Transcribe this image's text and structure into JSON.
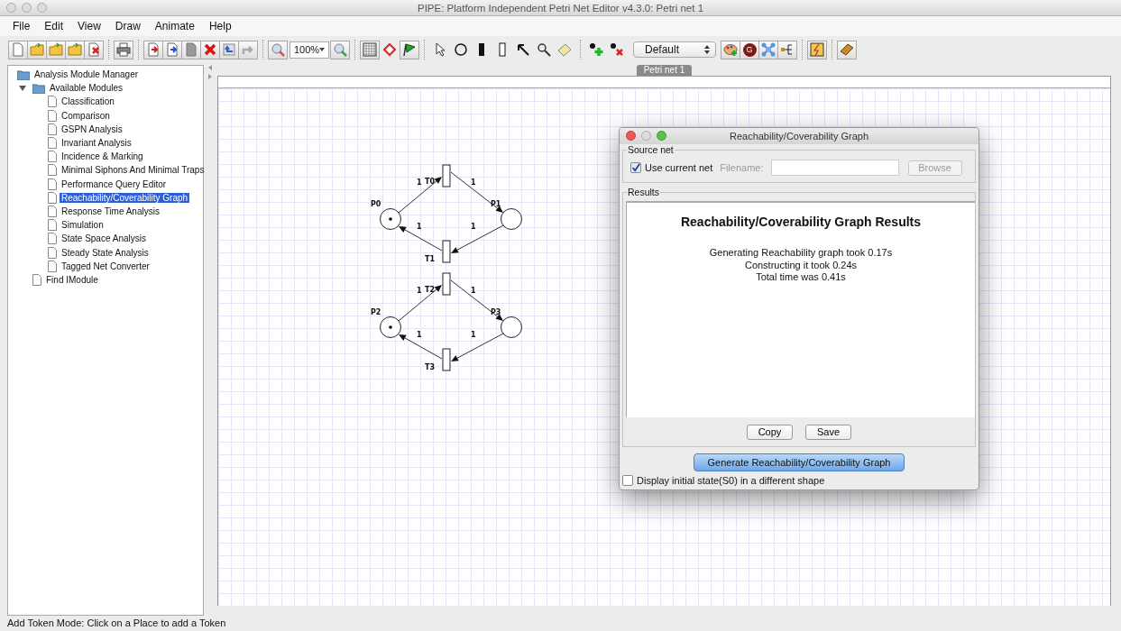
{
  "window": {
    "title": "PIPE: Platform Independent Petri Net Editor v4.3.0: Petri net 1"
  },
  "menu": [
    "File",
    "Edit",
    "View",
    "Draw",
    "Animate",
    "Help"
  ],
  "toolbar": {
    "zoom": "100%",
    "token_set": "Default",
    "rate_letter": "G"
  },
  "tree": [
    {
      "label": "Analysis Module Manager",
      "selected": false,
      "children": [
        {
          "label": "Available Modules",
          "selected": false,
          "expanded": true,
          "children": [
            {
              "label": "Classification",
              "selected": false
            },
            {
              "label": "Comparison",
              "selected": false
            },
            {
              "label": "GSPN Analysis",
              "selected": false
            },
            {
              "label": "Invariant Analysis",
              "selected": false
            },
            {
              "label": "Incidence & Marking",
              "selected": false
            },
            {
              "label": "Minimal Siphons And Minimal Traps",
              "selected": false
            },
            {
              "label": "Performance Query Editor",
              "selected": false
            },
            {
              "label": "Reachability/Coverability Graph",
              "selected": true
            },
            {
              "label": "Response Time Analysis",
              "selected": false
            },
            {
              "label": "Simulation",
              "selected": false
            },
            {
              "label": "State Space Analysis",
              "selected": false
            },
            {
              "label": "Steady State Analysis",
              "selected": false
            },
            {
              "label": "Tagged Net Converter",
              "selected": false
            }
          ]
        },
        {
          "label": "Find IModule",
          "selected": false
        }
      ]
    }
  ],
  "canvas_tab": "Petri net 1",
  "nets": [
    {
      "places": [
        {
          "label": "P0",
          "marked": true
        },
        {
          "label": "P1",
          "marked": false
        }
      ],
      "transitions": [
        {
          "label": "T0"
        },
        {
          "label": "T1"
        }
      ],
      "arc_weights": [
        "1",
        "1",
        "1",
        "1"
      ]
    },
    {
      "places": [
        {
          "label": "P2",
          "marked": true
        },
        {
          "label": "P3",
          "marked": false
        }
      ],
      "transitions": [
        {
          "label": "T2"
        },
        {
          "label": "T3"
        }
      ],
      "arc_weights": [
        "1",
        "1",
        "1",
        "1"
      ]
    }
  ],
  "dialog": {
    "title": "Reachability/Coverability Graph",
    "source_net": {
      "legend": "Source net",
      "use_current": {
        "label": "Use current net",
        "checked": true
      },
      "filename_label": "Filename:",
      "browse": "Browse"
    },
    "results": {
      "legend": "Results",
      "heading": "Reachability/Coverability Graph Results",
      "lines": [
        "Generating Reachability graph took 0.17s",
        "Constructing it took 0.24s",
        "Total time was 0.41s"
      ],
      "buttons": [
        "Copy",
        "Save"
      ]
    },
    "generate": "Generate Reachability/Coverability Graph",
    "initial_state": {
      "label": "Display initial state(S0) in a different shape",
      "checked": false
    }
  },
  "status_bar": "Add Token Mode: Click on a Place to add a Token"
}
